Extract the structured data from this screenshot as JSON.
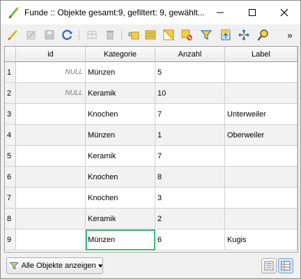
{
  "window": {
    "title": "Funde :: Objekte gesamt:9, gefiltert: 9, gewählt...",
    "minimize_icon": "minimize-icon",
    "maximize_icon": "maximize-icon",
    "close_icon": "close-icon"
  },
  "toolbar": {
    "buttons": [
      {
        "icon": "pencil-edit-icon",
        "enabled": true
      },
      {
        "icon": "multi-edit-icon",
        "enabled": false
      },
      {
        "icon": "save-icon",
        "enabled": false
      },
      {
        "icon": "reload-icon",
        "enabled": true
      },
      {
        "icon": "add-feature-icon",
        "enabled": false
      },
      {
        "icon": "delete-icon",
        "enabled": false
      },
      {
        "icon": "select-by-expression-icon",
        "enabled": true
      },
      {
        "icon": "select-all-icon",
        "enabled": true
      },
      {
        "icon": "invert-selection-icon",
        "enabled": true
      },
      {
        "icon": "deselect-icon",
        "enabled": true
      },
      {
        "icon": "filter-icon",
        "enabled": true
      },
      {
        "icon": "move-selection-top-icon",
        "enabled": true
      },
      {
        "icon": "pan-to-selection-icon",
        "enabled": true
      },
      {
        "icon": "zoom-to-selection-icon",
        "enabled": true
      }
    ],
    "overflow": "»"
  },
  "table": {
    "columns": [
      "id",
      "Kategorie",
      "Anzahl",
      "Label"
    ],
    "rows": [
      {
        "num": "1",
        "id": "NULL",
        "Kategorie": "Münzen",
        "Anzahl": "5",
        "Label": ""
      },
      {
        "num": "2",
        "id": "NULL",
        "Kategorie": "Keramik",
        "Anzahl": "10",
        "Label": ""
      },
      {
        "num": "3",
        "id": "",
        "Kategorie": "Knochen",
        "Anzahl": "7",
        "Label": "Unterweiler"
      },
      {
        "num": "4",
        "id": "",
        "Kategorie": "Münzen",
        "Anzahl": "1",
        "Label": "Oberweiler"
      },
      {
        "num": "5",
        "id": "",
        "Kategorie": "Keramik",
        "Anzahl": "7",
        "Label": ""
      },
      {
        "num": "6",
        "id": "",
        "Kategorie": "Knochen",
        "Anzahl": "8",
        "Label": ""
      },
      {
        "num": "7",
        "id": "",
        "Kategorie": "Knochen",
        "Anzahl": "3",
        "Label": ""
      },
      {
        "num": "8",
        "id": "",
        "Kategorie": "Keramik",
        "Anzahl": "2",
        "Label": ""
      },
      {
        "num": "9",
        "id": "",
        "Kategorie": "Münzen",
        "Anzahl": "6",
        "Label": "Kugis"
      }
    ],
    "selected_cell": {
      "row": "9",
      "column": "Kategorie"
    }
  },
  "bottom": {
    "filter_button_label": "Alle Objekte anzeigen",
    "view_buttons": [
      "form-view-icon",
      "table-view-icon"
    ]
  },
  "colors": {
    "selection_outline": "#3cba7a",
    "alt_row": "#f2f2f2"
  }
}
